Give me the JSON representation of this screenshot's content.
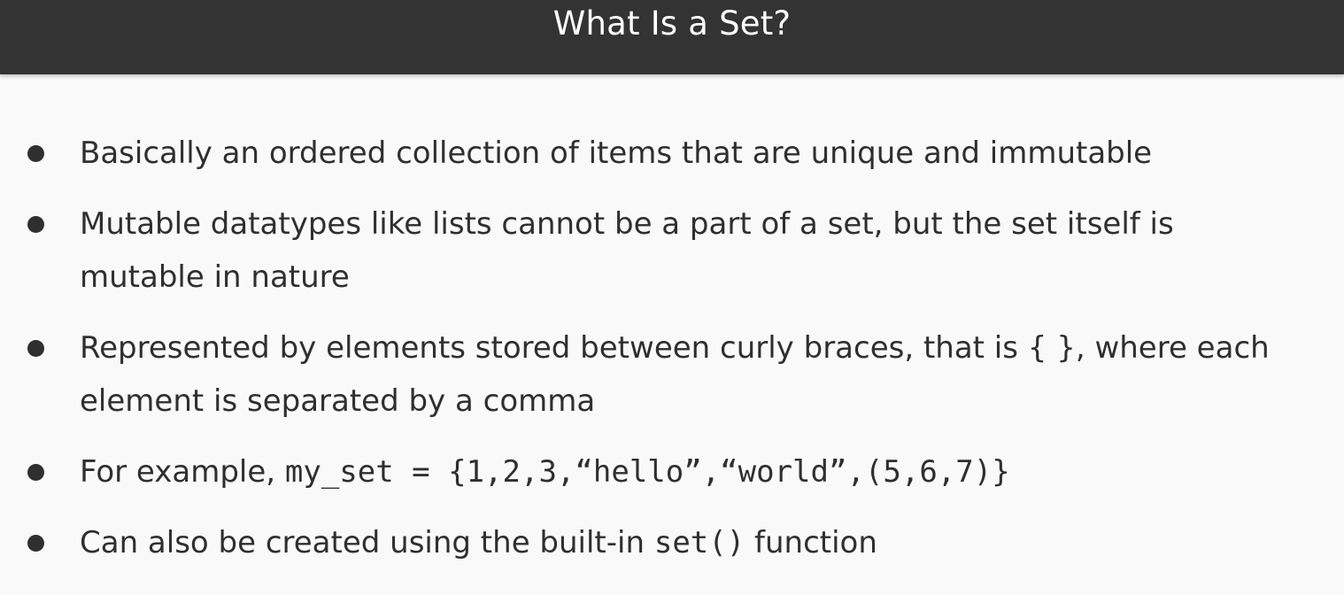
{
  "slide": {
    "title": "What Is a Set?"
  },
  "bullets": [
    {
      "line1": "Basically an ordered collection of items that are unique and immutable"
    },
    {
      "line1": "Mutable datatypes like lists cannot be a part of a set, but the set itself is",
      "line2": "mutable in nature"
    },
    {
      "line1": "Represented by elements stored between curly braces, that is { }, where each",
      "line2": "element is separated by a comma"
    },
    {
      "prefix": "For example, ",
      "code": "my_set = {1,2,3,“hello”,“world”,(5,6,7)}"
    },
    {
      "prefix": "Can also be created using the built-in ",
      "code": "set()",
      "suffix": " function"
    }
  ]
}
